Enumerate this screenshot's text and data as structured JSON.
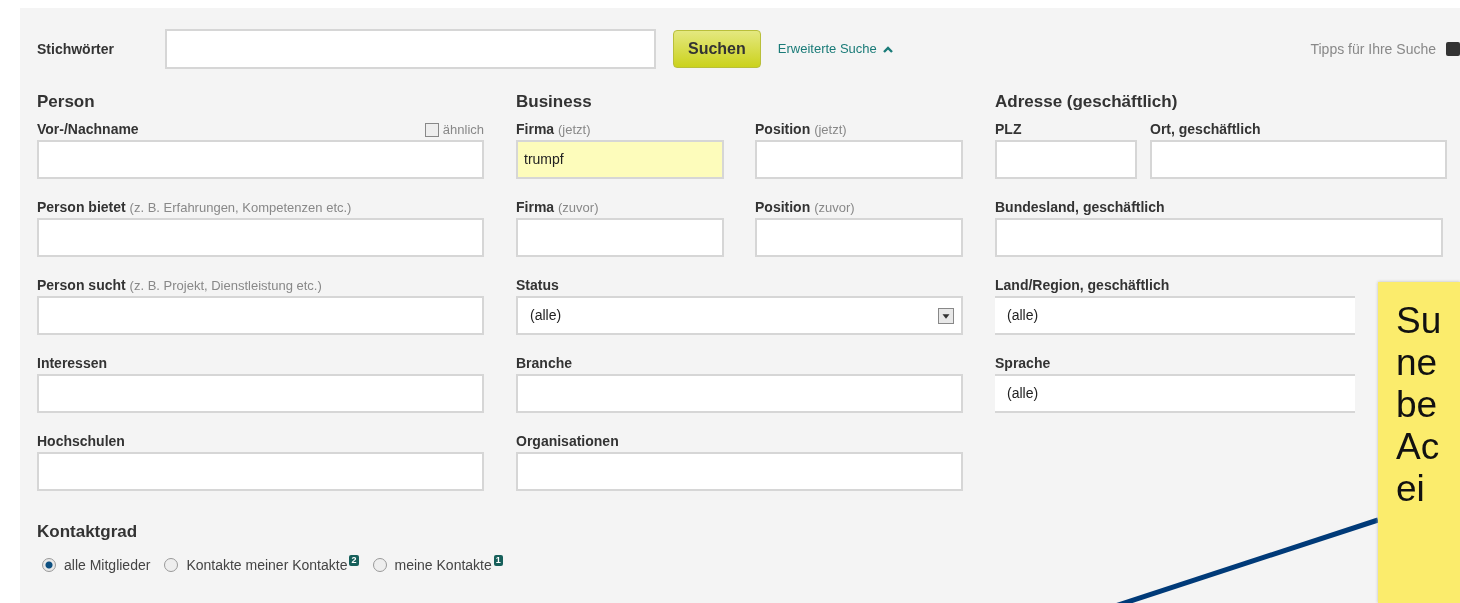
{
  "search_bar": {
    "label": "Stichwörter",
    "button": "Suchen",
    "advanced_link": "Erweiterte Suche",
    "tips_link": "Tipps für Ihre Suche"
  },
  "sections": [
    {
      "title": "Person",
      "rows": [
        [
          {
            "kind": "text",
            "label": "Vor-/Nachname",
            "similar": {
              "label": "ähnlich",
              "checked": false
            }
          }
        ],
        [
          {
            "kind": "text",
            "label": "Person bietet",
            "hint": "(z. B. Erfahrungen, Kompetenzen etc.)"
          }
        ],
        [
          {
            "kind": "text",
            "label": "Person sucht",
            "hint": "(z. B. Projekt, Dienstleistung etc.)"
          }
        ],
        [
          {
            "kind": "text",
            "label": "Interessen"
          }
        ],
        [
          {
            "kind": "text",
            "label": "Hochschulen"
          }
        ]
      ]
    },
    {
      "title": "Business",
      "rows": [
        [
          {
            "kind": "text",
            "label": "Firma",
            "hint": "(jetzt)",
            "value": "trumpf"
          },
          {
            "kind": "text",
            "label": "Position",
            "hint": "(jetzt)"
          }
        ],
        [
          {
            "kind": "text",
            "label": "Firma",
            "hint": "(zuvor)"
          },
          {
            "kind": "text",
            "label": "Position",
            "hint": "(zuvor)"
          }
        ],
        [
          {
            "kind": "select",
            "label": "Status",
            "value": "(alle)"
          }
        ],
        [
          {
            "kind": "text",
            "label": "Branche"
          }
        ],
        [
          {
            "kind": "text",
            "label": "Organisationen"
          }
        ]
      ]
    },
    {
      "title": "Adresse (geschäftlich)",
      "rows": [
        [
          {
            "kind": "text",
            "label": "PLZ"
          },
          {
            "kind": "text",
            "label": "Ort, geschäftlich"
          }
        ],
        [
          {
            "kind": "text",
            "label": "Bundesland, geschäftlich"
          }
        ],
        [
          {
            "kind": "plain-select",
            "label": "Land/Region, geschäftlich",
            "value": "(alle)"
          }
        ],
        [
          {
            "kind": "plain-select",
            "label": "Sprache",
            "value": "(alle)"
          }
        ]
      ]
    }
  ],
  "contact_degree": {
    "title": "Kontaktgrad",
    "options": [
      {
        "label": "alle Mitglieder",
        "selected": true
      },
      {
        "label": "Kontakte meiner Kontakte",
        "selected": false,
        "badge": "2"
      },
      {
        "label": "meine Kontakte",
        "selected": false,
        "badge": "1"
      }
    ]
  },
  "callout": {
    "lines": [
      "Su",
      "ne",
      "be",
      "Ac",
      "ei"
    ]
  }
}
